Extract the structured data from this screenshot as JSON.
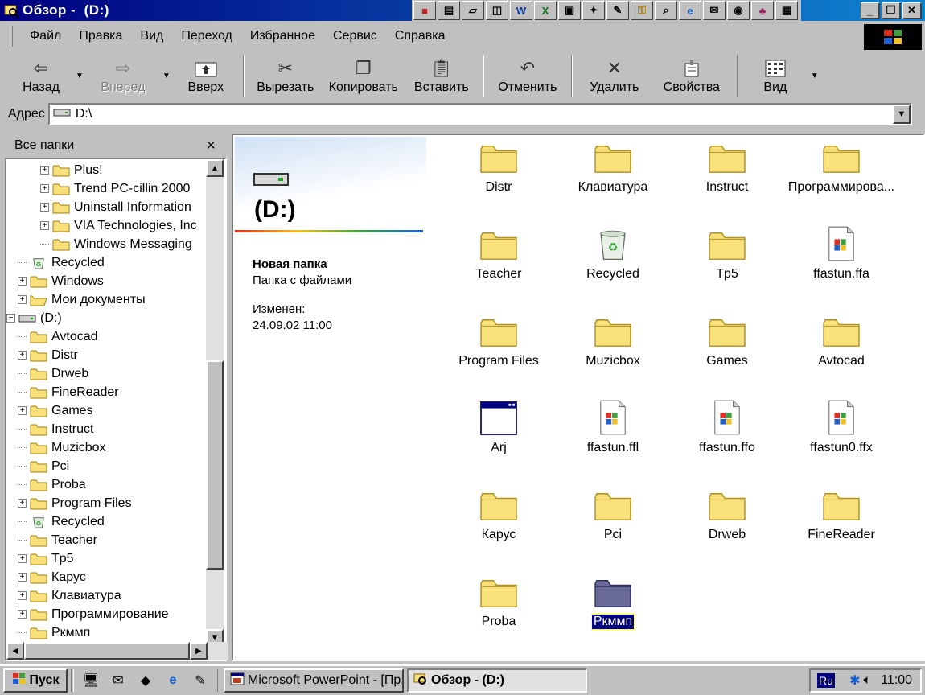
{
  "window": {
    "title": "Обзор -  (D:)",
    "title_icon": "explorer-icon"
  },
  "quick_icons": [
    "flag-icon",
    "notepad-icon",
    "folder-open-icon",
    "network-icon",
    "word-icon",
    "excel-icon",
    "media-icon",
    "tool-icon",
    "paint-icon",
    "key-icon",
    "search-icon",
    "ie-icon",
    "mail-icon",
    "disk-icon",
    "game-icon",
    "screen-icon"
  ],
  "menu": [
    "Файл",
    "Правка",
    "Вид",
    "Переход",
    "Избранное",
    "Сервис",
    "Справка"
  ],
  "toolbar": {
    "back": "Назад",
    "forward": "Вперед",
    "up": "Вверх",
    "cut": "Вырезать",
    "copy": "Копировать",
    "paste": "Вставить",
    "undo": "Отменить",
    "delete": "Удалить",
    "properties": "Свойства",
    "view": "Вид"
  },
  "address": {
    "label": "Адрес",
    "value": "D:\\"
  },
  "folders_panel": {
    "title": "Все папки",
    "close": "×",
    "items": [
      {
        "label": "Plus!",
        "indent": 2,
        "expand": "+",
        "icon": "folder"
      },
      {
        "label": "Trend PC-cillin 2000",
        "indent": 2,
        "expand": "+",
        "icon": "folder"
      },
      {
        "label": "Uninstall Information",
        "indent": 2,
        "expand": "+",
        "icon": "folder"
      },
      {
        "label": "VIA Technologies, Inc",
        "indent": 2,
        "expand": "+",
        "icon": "folder"
      },
      {
        "label": "Windows Messaging",
        "indent": 2,
        "expand": "",
        "icon": "folder"
      },
      {
        "label": "Recycled",
        "indent": 1,
        "expand": "",
        "icon": "recycle"
      },
      {
        "label": "Windows",
        "indent": 1,
        "expand": "+",
        "icon": "folder"
      },
      {
        "label": "Мои документы",
        "indent": 1,
        "expand": "+",
        "icon": "folder-open"
      },
      {
        "label": "(D:)",
        "indent": 0,
        "expand": "-",
        "icon": "drive"
      },
      {
        "label": "Avtocad",
        "indent": 1,
        "expand": "",
        "icon": "folder"
      },
      {
        "label": "Distr",
        "indent": 1,
        "expand": "+",
        "icon": "folder"
      },
      {
        "label": "Drweb",
        "indent": 1,
        "expand": "",
        "icon": "folder"
      },
      {
        "label": "FineReader",
        "indent": 1,
        "expand": "",
        "icon": "folder"
      },
      {
        "label": "Games",
        "indent": 1,
        "expand": "+",
        "icon": "folder"
      },
      {
        "label": "Instruct",
        "indent": 1,
        "expand": "",
        "icon": "folder"
      },
      {
        "label": "Muzicbox",
        "indent": 1,
        "expand": "",
        "icon": "folder"
      },
      {
        "label": "Pci",
        "indent": 1,
        "expand": "",
        "icon": "folder"
      },
      {
        "label": "Proba",
        "indent": 1,
        "expand": "",
        "icon": "folder"
      },
      {
        "label": "Program Files",
        "indent": 1,
        "expand": "+",
        "icon": "folder"
      },
      {
        "label": "Recycled",
        "indent": 1,
        "expand": "",
        "icon": "recycle"
      },
      {
        "label": "Teacher",
        "indent": 1,
        "expand": "",
        "icon": "folder"
      },
      {
        "label": "Tp5",
        "indent": 1,
        "expand": "+",
        "icon": "folder"
      },
      {
        "label": "Карус",
        "indent": 1,
        "expand": "+",
        "icon": "folder"
      },
      {
        "label": "Клавиатура",
        "indent": 1,
        "expand": "+",
        "icon": "folder"
      },
      {
        "label": "Программирование",
        "indent": 1,
        "expand": "+",
        "icon": "folder"
      },
      {
        "label": "Ркммп",
        "indent": 1,
        "expand": "",
        "icon": "folder"
      }
    ]
  },
  "info": {
    "drive_title": "(D:)",
    "folder_name": "Новая папка",
    "folder_desc": "Папка с файлами",
    "modified_label": "Изменен:",
    "modified_date": "24.09.02 11:00"
  },
  "files": [
    {
      "name": "Distr",
      "icon": "folder"
    },
    {
      "name": "Клавиатура",
      "icon": "folder"
    },
    {
      "name": "Instruct",
      "icon": "folder"
    },
    {
      "name": "Программирова...",
      "icon": "folder"
    },
    {
      "name": "Teacher",
      "icon": "folder"
    },
    {
      "name": "Recycled",
      "icon": "recycle"
    },
    {
      "name": "Tp5",
      "icon": "folder"
    },
    {
      "name": "ffastun.ffa",
      "icon": "doc"
    },
    {
      "name": "Program Files",
      "icon": "folder"
    },
    {
      "name": "Muzicbox",
      "icon": "folder"
    },
    {
      "name": "Games",
      "icon": "folder"
    },
    {
      "name": "Avtocad",
      "icon": "folder"
    },
    {
      "name": "Arj",
      "icon": "window"
    },
    {
      "name": "ffastun.ffl",
      "icon": "doc"
    },
    {
      "name": "ffastun.ffo",
      "icon": "doc"
    },
    {
      "name": "ffastun0.ffx",
      "icon": "doc"
    },
    {
      "name": "Карус",
      "icon": "folder"
    },
    {
      "name": "Pci",
      "icon": "folder"
    },
    {
      "name": "Drweb",
      "icon": "folder"
    },
    {
      "name": "FineReader",
      "icon": "folder"
    },
    {
      "name": "Proba",
      "icon": "folder"
    },
    {
      "name": "Ркммп",
      "icon": "folder-selected",
      "selected": true
    }
  ],
  "taskbar": {
    "start": "Пуск",
    "tasks": [
      "Microsoft PowerPoint - [Пр...",
      "Обзор -  (D:)"
    ],
    "lang": "Ru",
    "clock": "11:00"
  },
  "colors": {
    "title_start": "#000080",
    "title_end": "#1084d0",
    "folder": "#f8e07a",
    "selection": "#000080"
  }
}
